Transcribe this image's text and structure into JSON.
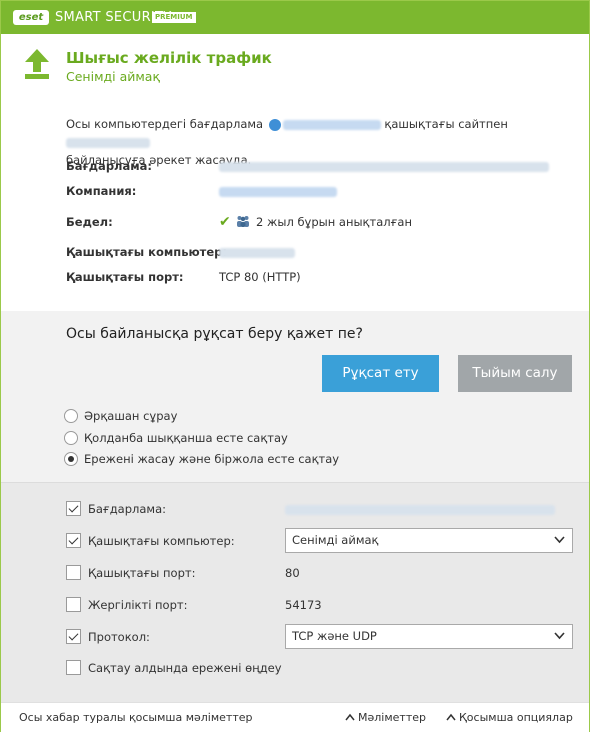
{
  "titlebar": {
    "logo": "eset",
    "brand": "SMART SECURITY",
    "edition": "PREMIUM",
    "accent": "#7cb82f"
  },
  "alert": {
    "icon": "upload-arrow-icon",
    "title": "Шығыс желілік трафик",
    "subtitle": "Сенімді аймақ",
    "desc_part1": "Осы компьютердегі бағдарлама",
    "desc_part2": "қашықтағы сайтпен",
    "desc_part3": "байланысуға әрекет жасауда."
  },
  "details": {
    "program_label": "Бағдарлама:",
    "company_label": "Компания:",
    "reputation_label": "Бедел:",
    "reputation_value": "2 жыл бұрын анықталған",
    "remote_computer_label": "Қашықтағы компьютер:",
    "remote_port_label": "Қашықтағы порт:",
    "remote_port_value": "TCP 80 (HTTP)"
  },
  "prompt": {
    "question": "Осы байланысқа рұқсат беру қажет пе?",
    "allow_label": "Рұқсат ету",
    "deny_label": "Тыйым салу",
    "allow_color": "#3aa0d8",
    "deny_color": "#a1a6a9",
    "options": [
      {
        "label": "Әрқашан сұрау",
        "selected": false
      },
      {
        "label": "Қолданба шыққанша есте сақтау",
        "selected": false
      },
      {
        "label": "Ережені жасау және біржола есте сақтау",
        "selected": true
      }
    ]
  },
  "rule": {
    "program_label": "Бағдарлама:",
    "program_checked": true,
    "remote_computer_label": "Қашықтағы компьютер:",
    "remote_computer_checked": true,
    "remote_computer_value": "Сенімді аймақ",
    "remote_port_label": "Қашықтағы порт:",
    "remote_port_checked": false,
    "remote_port_value": "80",
    "local_port_label": "Жергілікті порт:",
    "local_port_checked": false,
    "local_port_value": "54173",
    "protocol_label": "Протокол:",
    "protocol_checked": true,
    "protocol_value": "TCP және UDP",
    "edit_rule_label": "Сақтау алдында ережені өңдеу",
    "edit_rule_checked": false
  },
  "footer": {
    "more_info": "Осы хабар туралы қосымша мәліметтер",
    "details_link": "Мәліметтер",
    "advanced_link": "Қосымша опциялар"
  }
}
